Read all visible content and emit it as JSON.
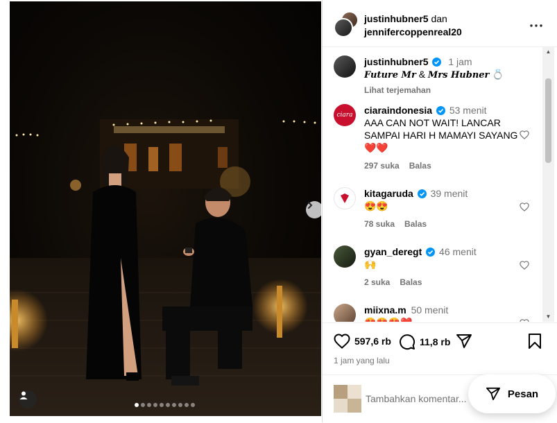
{
  "post": {
    "photo_alt": "",
    "carousel": {
      "total_slides": 10,
      "active_index": 0
    }
  },
  "header": {
    "author": "justinhubner5",
    "joiner": "dan",
    "coauthor": "jennifercoppenreal20",
    "more_icon": "more-horizontal-icon"
  },
  "caption": {
    "username": "justinhubner5",
    "time": "1 jam",
    "text_a": "Future Mr",
    "amp": "&",
    "text_b": "Mrs Hubner",
    "emoji": "💍",
    "see_translation": "Lihat terjemahan"
  },
  "comments": [
    {
      "username": "ciaraindonesia",
      "time": "53 menit",
      "text": "AAA CAN NOT WAIT! LANCAR SAMPAI HARI H MAMAYI SAYANG ❤️❤️",
      "likes": "297 suka",
      "reply": "Balas"
    },
    {
      "username": "kitagaruda",
      "time": "39 menit",
      "text": "😍😍",
      "likes": "78 suka",
      "reply": "Balas"
    },
    {
      "username": "gyan_deregt",
      "time": "46 menit",
      "text": "🙌",
      "likes": "2 suka",
      "reply": "Balas"
    },
    {
      "username": "miixna.m",
      "time": "50 menit",
      "text": "😍😍😍❤️",
      "likes": "",
      "reply": ""
    }
  ],
  "actions": {
    "like_count": "597,6 rb",
    "comment_count": "11,8 rb",
    "share_icon": "paper-plane-icon",
    "save_icon": "bookmark-icon"
  },
  "posted_time": "1 jam yang lalu",
  "add_comment": {
    "placeholder": "Tambahkan komentar..."
  },
  "message_button": {
    "label": "Pesan"
  },
  "colors": {
    "verified": "#0095f6",
    "heart_red": "#ff3040",
    "muted": "#737373"
  }
}
